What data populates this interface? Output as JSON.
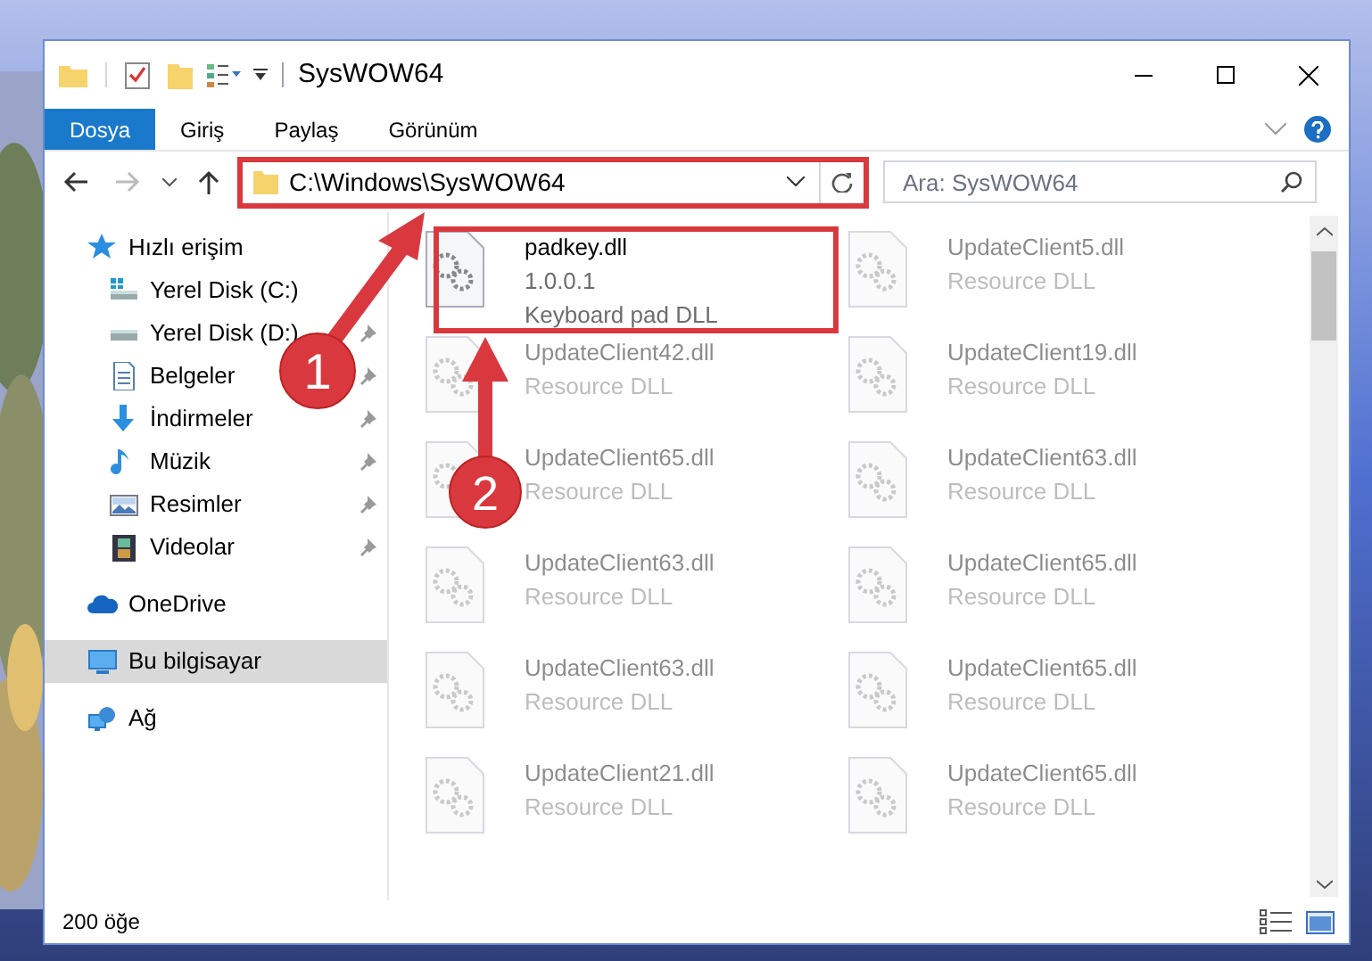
{
  "window": {
    "title": "SysWOW64"
  },
  "ribbon_tabs": [
    {
      "label": "Dosya",
      "selected": true
    },
    {
      "label": "Giriş",
      "selected": false
    },
    {
      "label": "Paylaş",
      "selected": false
    },
    {
      "label": "Görünüm",
      "selected": false
    }
  ],
  "address": {
    "path": "C:\\Windows\\SysWOW64"
  },
  "search": {
    "placeholder": "Ara: SysWOW64"
  },
  "sidebar": {
    "items": [
      {
        "label": "Hızlı erişim",
        "kind": "star",
        "selected": false,
        "children": [
          {
            "label": "Yerel Disk (C:)",
            "kind": "windrive",
            "pinned": false,
            "selected": false
          },
          {
            "label": "Yerel Disk (D:)",
            "kind": "drive",
            "pinned": true,
            "selected": false
          },
          {
            "label": "Belgeler",
            "kind": "document",
            "pinned": true,
            "selected": false
          },
          {
            "label": "İndirmeler",
            "kind": "download",
            "pinned": true,
            "selected": false
          },
          {
            "label": "Müzik",
            "kind": "music",
            "pinned": true,
            "selected": false
          },
          {
            "label": "Resimler",
            "kind": "pictures",
            "pinned": true,
            "selected": false
          },
          {
            "label": "Videolar",
            "kind": "video",
            "pinned": true,
            "selected": false
          }
        ]
      },
      {
        "label": "OneDrive",
        "kind": "cloud",
        "selected": false
      },
      {
        "label": "Bu bilgisayar",
        "kind": "computer",
        "selected": true
      },
      {
        "label": "Ağ",
        "kind": "network",
        "selected": false
      }
    ]
  },
  "files": [
    {
      "name": "padkey.dll",
      "lines": [
        "1.0.0.1",
        "Keyboard pad DLL"
      ],
      "faded": false
    },
    {
      "name": "UpdateClient5.dll",
      "lines": [
        "Resource DLL"
      ],
      "faded": true
    },
    {
      "name": "UpdateClient42.dll",
      "lines": [
        "Resource DLL"
      ],
      "faded": true
    },
    {
      "name": "UpdateClient19.dll",
      "lines": [
        "Resource DLL"
      ],
      "faded": true
    },
    {
      "name": "UpdateClient65.dll",
      "lines": [
        "Resource DLL"
      ],
      "faded": true
    },
    {
      "name": "UpdateClient63.dll",
      "lines": [
        "Resource DLL"
      ],
      "faded": true
    },
    {
      "name": "UpdateClient63.dll",
      "lines": [
        "Resource DLL"
      ],
      "faded": true
    },
    {
      "name": "UpdateClient65.dll",
      "lines": [
        "Resource DLL"
      ],
      "faded": true
    },
    {
      "name": "UpdateClient63.dll",
      "lines": [
        "Resource DLL"
      ],
      "faded": true
    },
    {
      "name": "UpdateClient65.dll",
      "lines": [
        "Resource DLL"
      ],
      "faded": true
    },
    {
      "name": "UpdateClient21.dll",
      "lines": [
        "Resource DLL"
      ],
      "faded": true
    },
    {
      "name": "UpdateClient65.dll",
      "lines": [
        "Resource DLL"
      ],
      "faded": true
    }
  ],
  "status_bar": {
    "count": "200 öğe"
  },
  "annotations": [
    {
      "number": "1"
    },
    {
      "number": "2"
    }
  ]
}
